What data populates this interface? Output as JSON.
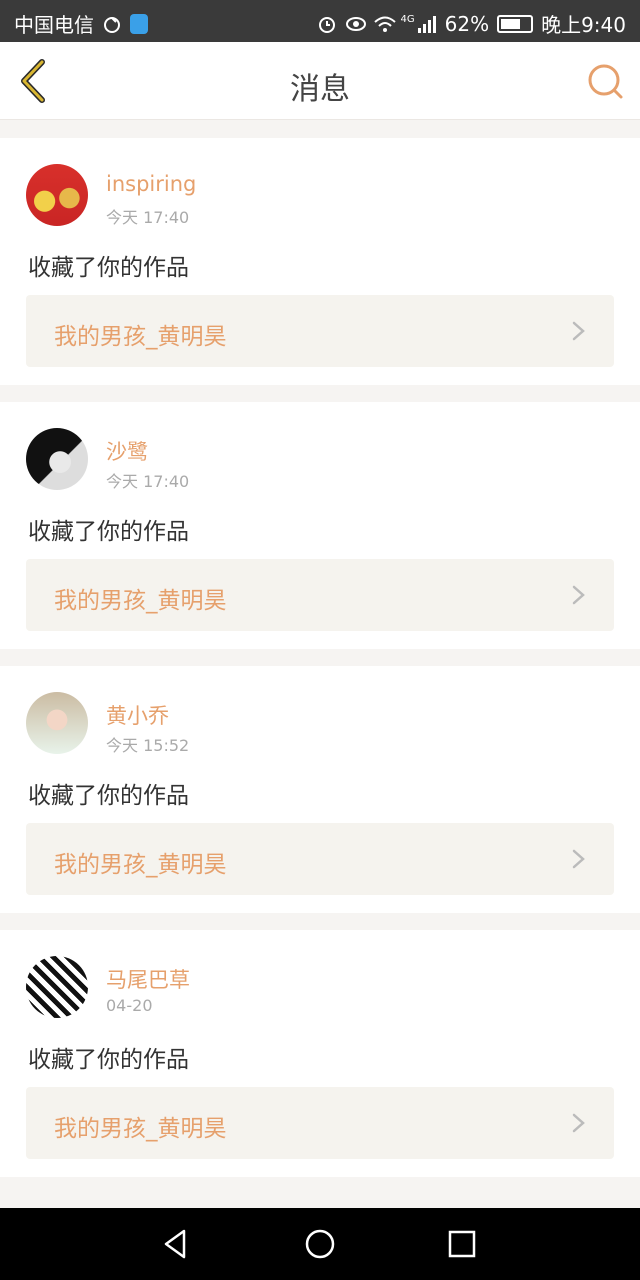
{
  "status_bar": {
    "carrier": "中国电信",
    "battery": "62%",
    "time": "晚上9:40",
    "network": "4G"
  },
  "header": {
    "title": "消息",
    "back_icon": "chevron-left-icon",
    "search_icon": "search-icon"
  },
  "colors": {
    "accent": "#e6a06c",
    "back_icon": "#d8b632",
    "card_link_bg": "#f5f3ee"
  },
  "messages": [
    {
      "name": "inspiring",
      "time": "今天 17:40",
      "action": "收藏了你的作品",
      "work_title": "我的男孩_黄明昊"
    },
    {
      "name": "沙鹭",
      "time": "今天 17:40",
      "action": "收藏了你的作品",
      "work_title": "我的男孩_黄明昊"
    },
    {
      "name": "黄小乔",
      "time": "今天 15:52",
      "action": "收藏了你的作品",
      "work_title": "我的男孩_黄明昊"
    },
    {
      "name": "马尾巴草",
      "time": "04-20",
      "action": "收藏了你的作品",
      "work_title": "我的男孩_黄明昊"
    }
  ]
}
